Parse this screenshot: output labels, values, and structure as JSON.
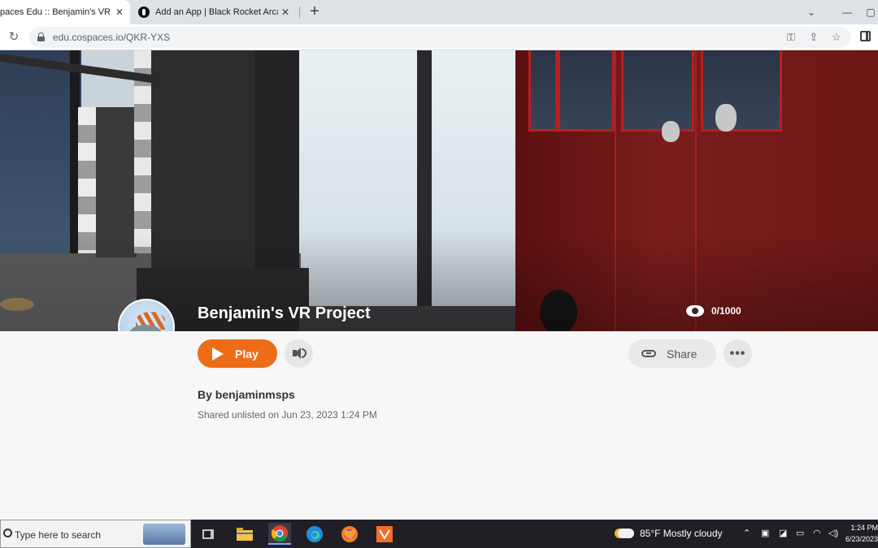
{
  "browser": {
    "tabs": [
      {
        "title": "paces Edu :: Benjamin's VR Pr",
        "active": true
      },
      {
        "title": "Add an App | Black Rocket Arcad",
        "active": false
      }
    ],
    "url": "edu.cospaces.io/QKR-YXS"
  },
  "project": {
    "title": "Benjamin's VR Project",
    "views": "0/1000",
    "play_label": "Play",
    "share_label": "Share",
    "more_label": "•••",
    "author": "By benjaminmsps",
    "shared_text": "Shared unlisted on Jun 23, 2023 1:24 PM"
  },
  "taskbar": {
    "search_placeholder": "Type here to search",
    "weather": "85°F  Mostly cloudy",
    "time": "1:24 PM",
    "date": "6/23/2023"
  },
  "colors": {
    "accent": "#ef6c16",
    "bus_red": "#7a1c1c",
    "taskbar": "#1f1f25"
  }
}
